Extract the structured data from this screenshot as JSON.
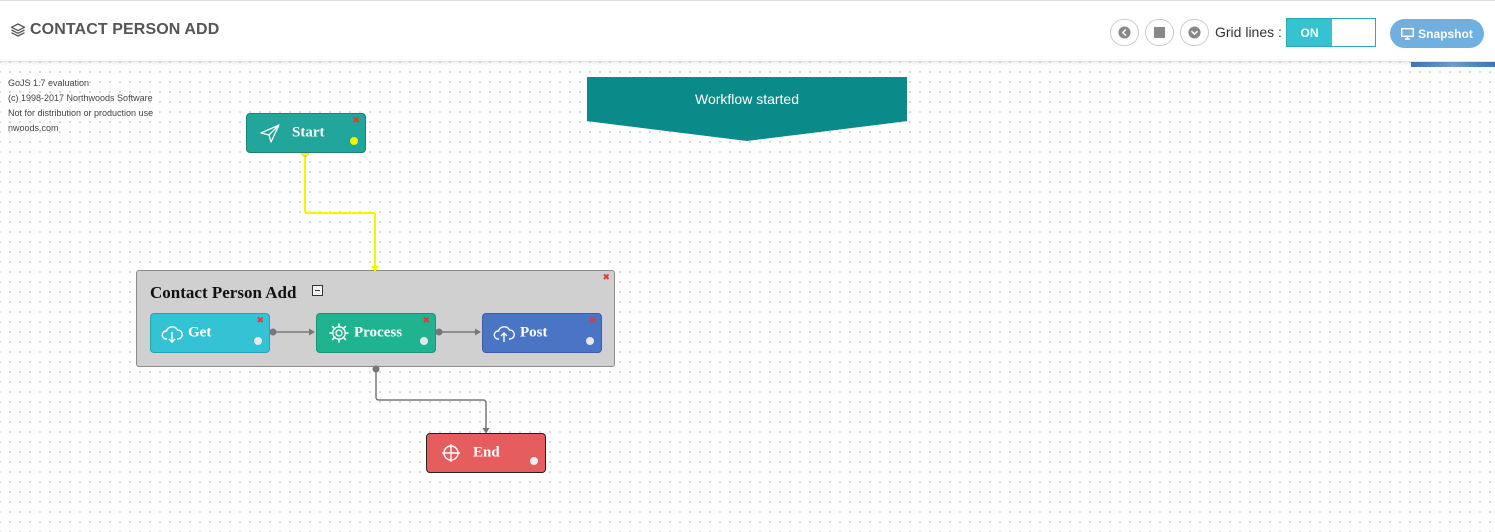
{
  "header": {
    "title": "CONTACT PERSON ADD",
    "grid_lines_label": "Grid lines :",
    "grid_toggle_label": "ON",
    "grid_on": true,
    "snapshot_label": "Snapshot"
  },
  "watermark": [
    "GoJS 1.7 evaluation",
    "(c) 1998-2017 Northwoods Software",
    "Not for distribution or production use",
    "nwoods.com"
  ],
  "banner": {
    "text": "Workflow started"
  },
  "nodes": {
    "start": {
      "label": "Start",
      "color": "#22a59a",
      "port_color": "#f5f500"
    },
    "get": {
      "label": "Get",
      "color": "#33c3d5"
    },
    "process": {
      "label": "Process",
      "color": "#1fb38f"
    },
    "post": {
      "label": "Post",
      "color": "#4a74c4"
    },
    "end": {
      "label": "End",
      "color": "#e55d5d"
    }
  },
  "group": {
    "title": "Contact Person Add"
  },
  "colors": {
    "active_link": "#f5f500",
    "link": "#777777",
    "banner": "#0a8a88",
    "accent": "#35c2d1",
    "delete": "#e53935"
  },
  "icons": {
    "title": "layers-icon",
    "back": "arrow-left-circle-icon",
    "stop": "stop-icon",
    "down": "arrow-down-circle-icon",
    "snapshot": "monitor-icon",
    "start": "send-icon",
    "get": "cloud-download-icon",
    "process": "gear-icon",
    "post": "cloud-upload-icon",
    "end": "crosshair-icon"
  }
}
